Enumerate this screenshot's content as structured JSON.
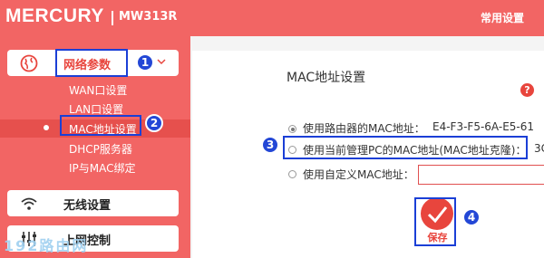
{
  "header": {
    "brand": "MERCURY",
    "model": "MW313R",
    "common_settings": "常用设置"
  },
  "sidebar": {
    "network_params": "网络参数",
    "sub_items": [
      "WAN口设置",
      "LAN口设置",
      "MAC地址设置",
      "DHCP服务器",
      "IP与MAC绑定"
    ],
    "wireless": "无线设置",
    "access_control": "上网控制"
  },
  "main": {
    "title": "MAC地址设置",
    "help": "?",
    "opt_router_mac": "使用路由器的MAC地址：",
    "router_mac_value": "E4-F3-F5-6A-E5-61",
    "opt_pc_mac": "使用当前管理PC的MAC地址(MAC地址克隆)：",
    "pc_mac_value": "3C",
    "opt_custom_mac": "使用自定义MAC地址：",
    "custom_mac_value": "",
    "save": "保存"
  },
  "annotations": [
    "1",
    "2",
    "3",
    "4"
  ],
  "watermark": "192路由网",
  "colors": {
    "brand_red": "#f26564",
    "accent_red": "#e8453d",
    "annotation_blue": "#1b3fd6"
  }
}
